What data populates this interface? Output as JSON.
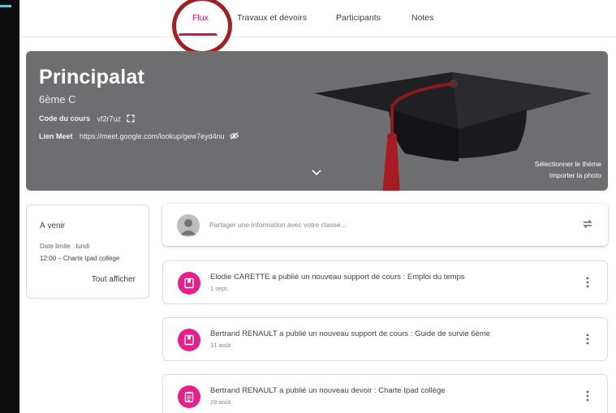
{
  "colors": {
    "accent": "#c2185b",
    "post_icon": "#e91e8c",
    "banner": "#6e6e70",
    "highlight_circle": "#a11f23"
  },
  "nav": {
    "tabs": [
      {
        "label": "Flux",
        "active": true
      },
      {
        "label": "Travaux et devoirs",
        "active": false
      },
      {
        "label": "Participants",
        "active": false
      },
      {
        "label": "Notes",
        "active": false
      }
    ]
  },
  "banner": {
    "title": "Principalat",
    "subtitle": "6ème C",
    "code_label": "Code du cours",
    "code_value": "vf2r7uz",
    "meet_label": "Lien Meet",
    "meet_url": "https://meet.google.com/lookup/gew7eyd4nu",
    "select_theme": "Sélectionner le thème",
    "upload_photo": "Importer la photo",
    "icons": [
      "fullscreen-icon",
      "visibility-off-icon",
      "chevron-down-icon",
      "graduation-cap-illustration"
    ]
  },
  "upcoming": {
    "title": "À venir",
    "due": "Date limite : lundi",
    "item": "12:00 – Charte Ipad collège",
    "view_all": "Tout afficher"
  },
  "share": {
    "placeholder": "Partager une information avec votre classe...",
    "icons": [
      "avatar-icon",
      "repost-icon"
    ]
  },
  "posts": [
    {
      "text": "Elodie CARETTE a publié un nouveau support de cours : Emploi du temps",
      "date": "1 sept.",
      "icon": "material-icon"
    },
    {
      "text": "Bertrand RENAULT a publié un nouveau support de cours : Guide de survie 6ème",
      "date": "31 août",
      "icon": "material-icon"
    },
    {
      "text": "Bertrand RENAULT a publié un nouveau devoir : Charte Ipad collège",
      "date": "29 août",
      "icon": "assignment-icon"
    }
  ]
}
